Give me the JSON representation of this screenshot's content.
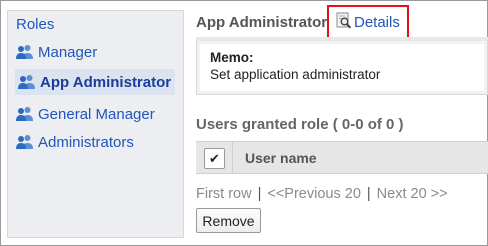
{
  "sidebar": {
    "title": "Roles",
    "items": [
      {
        "label": "Manager",
        "selected": false
      },
      {
        "label": "App Administrator",
        "selected": true
      },
      {
        "label": "General Manager",
        "selected": false
      },
      {
        "label": "Administrators",
        "selected": false
      }
    ]
  },
  "main": {
    "role_title": "App Administrator",
    "details_link": "Details",
    "memo": {
      "label": "Memo:",
      "text": "Set application administrator"
    },
    "users_heading": "Users granted role ( 0-0 of 0 )",
    "table": {
      "checkbox_glyph": "✔",
      "column_header": "User name"
    },
    "pager": {
      "first": "First row",
      "separator": "|",
      "previous": "<<Previous 20",
      "next": "Next 20 >>"
    },
    "remove_label": "Remove"
  },
  "colors": {
    "link": "#2255bb",
    "highlight_box": "#e0141b",
    "sidebar_bg": "#eceef1"
  }
}
